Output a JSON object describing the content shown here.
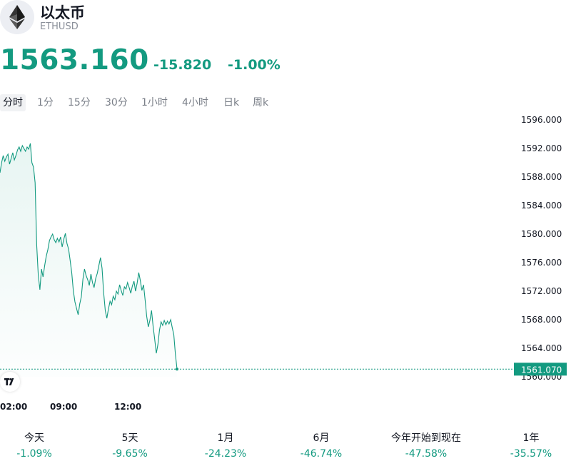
{
  "header": {
    "title": "以太币",
    "symbol": "ETHUSD",
    "logo_icon": "ethereum-icon"
  },
  "quote": {
    "price": "1563.160",
    "change": "-15.820",
    "change_pct": "-1.00%",
    "color": "#139a80"
  },
  "tabs": [
    "分时",
    "1分",
    "15分",
    "30分",
    "1小时",
    "4小时",
    "日k",
    "周k"
  ],
  "active_tab": 0,
  "chart_data": {
    "type": "area",
    "line_color": "#139a80",
    "y_ticks": [
      "1596.000",
      "1592.000",
      "1588.000",
      "1584.000",
      "1580.000",
      "1576.000",
      "1572.000",
      "1568.000",
      "1564.000",
      "1560.000"
    ],
    "ylim": [
      1560,
      1596
    ],
    "x_ticks": [
      "02:00",
      "09:00",
      "12:00"
    ],
    "last_value_label": "1561.070",
    "last_value": 1561.07,
    "points": [
      [
        0,
        1588.6
      ],
      [
        1,
        1590.0
      ],
      [
        2,
        1591.0
      ],
      [
        3,
        1590.2
      ],
      [
        4,
        1590.8
      ],
      [
        5,
        1591.2
      ],
      [
        6,
        1589.8
      ],
      [
        7,
        1590.6
      ],
      [
        8,
        1591.4
      ],
      [
        9,
        1590.4
      ],
      [
        10,
        1591.0
      ],
      [
        11,
        1591.8
      ],
      [
        12,
        1592.2
      ],
      [
        13,
        1591.6
      ],
      [
        14,
        1592.4
      ],
      [
        15,
        1592.0
      ],
      [
        16,
        1591.6
      ],
      [
        17,
        1592.2
      ],
      [
        18,
        1591.9
      ],
      [
        19,
        1592.7
      ],
      [
        20,
        1590.0
      ],
      [
        21,
        1589.4
      ],
      [
        22,
        1587.2
      ],
      [
        23,
        1578.5
      ],
      [
        24,
        1574.3
      ],
      [
        25,
        1572.2
      ],
      [
        26,
        1575.1
      ],
      [
        27,
        1574.0
      ],
      [
        28,
        1575.6
      ],
      [
        29,
        1576.9
      ],
      [
        30,
        1577.8
      ],
      [
        31,
        1579.1
      ],
      [
        32,
        1579.6
      ],
      [
        33,
        1580.0
      ],
      [
        34,
        1579.2
      ],
      [
        35,
        1578.8
      ],
      [
        36,
        1579.4
      ],
      [
        37,
        1578.9
      ],
      [
        38,
        1579.6
      ],
      [
        39,
        1578.2
      ],
      [
        40,
        1579.3
      ],
      [
        41,
        1580.1
      ],
      [
        42,
        1578.7
      ],
      [
        43,
        1577.9
      ],
      [
        44,
        1576.3
      ],
      [
        45,
        1574.6
      ],
      [
        46,
        1572.0
      ],
      [
        47,
        1570.5
      ],
      [
        48,
        1569.6
      ],
      [
        49,
        1568.7
      ],
      [
        50,
        1570.2
      ],
      [
        51,
        1571.2
      ],
      [
        52,
        1573.7
      ],
      [
        53,
        1575.1
      ],
      [
        54,
        1574.2
      ],
      [
        55,
        1573.6
      ],
      [
        56,
        1572.8
      ],
      [
        57,
        1574.4
      ],
      [
        58,
        1573.2
      ],
      [
        59,
        1572.5
      ],
      [
        60,
        1573.8
      ],
      [
        61,
        1574.5
      ],
      [
        62,
        1575.6
      ],
      [
        63,
        1576.7
      ],
      [
        64,
        1575.2
      ],
      [
        65,
        1571.8
      ],
      [
        66,
        1569.3
      ],
      [
        67,
        1568.2
      ],
      [
        68,
        1569.5
      ],
      [
        69,
        1570.6
      ],
      [
        70,
        1570.1
      ],
      [
        71,
        1571.3
      ],
      [
        72,
        1570.8
      ],
      [
        73,
        1572.0
      ],
      [
        74,
        1571.6
      ],
      [
        75,
        1572.9
      ],
      [
        76,
        1572.1
      ],
      [
        77,
        1571.4
      ],
      [
        78,
        1572.6
      ],
      [
        79,
        1572.3
      ],
      [
        80,
        1573.2
      ],
      [
        81,
        1572.5
      ],
      [
        82,
        1571.7
      ],
      [
        83,
        1572.7
      ],
      [
        84,
        1573.4
      ],
      [
        85,
        1572.0
      ],
      [
        86,
        1573.1
      ],
      [
        87,
        1574.6
      ],
      [
        88,
        1573.5
      ],
      [
        89,
        1572.1
      ],
      [
        90,
        1572.9
      ],
      [
        91,
        1570.8
      ],
      [
        92,
        1568.5
      ],
      [
        93,
        1567.0
      ],
      [
        94,
        1567.9
      ],
      [
        95,
        1569.3
      ],
      [
        96,
        1567.1
      ],
      [
        97,
        1565.3
      ],
      [
        98,
        1563.3
      ],
      [
        99,
        1564.5
      ],
      [
        100,
        1566.5
      ],
      [
        101,
        1567.7
      ],
      [
        102,
        1567.2
      ],
      [
        103,
        1567.9
      ],
      [
        104,
        1567.3
      ],
      [
        105,
        1567.8
      ],
      [
        106,
        1567.4
      ],
      [
        107,
        1568.0
      ],
      [
        108,
        1566.9
      ],
      [
        109,
        1565.9
      ],
      [
        110,
        1563.1
      ],
      [
        111,
        1561.1
      ]
    ]
  },
  "periods": [
    {
      "label": "今天",
      "value": "-1.09%"
    },
    {
      "label": "5天",
      "value": "-9.65%"
    },
    {
      "label": "1月",
      "value": "-24.23%"
    },
    {
      "label": "6月",
      "value": "-46.74%"
    },
    {
      "label": "今年开始到现在",
      "value": "-47.58%"
    },
    {
      "label": "1年",
      "value": "-35.57%"
    }
  ]
}
